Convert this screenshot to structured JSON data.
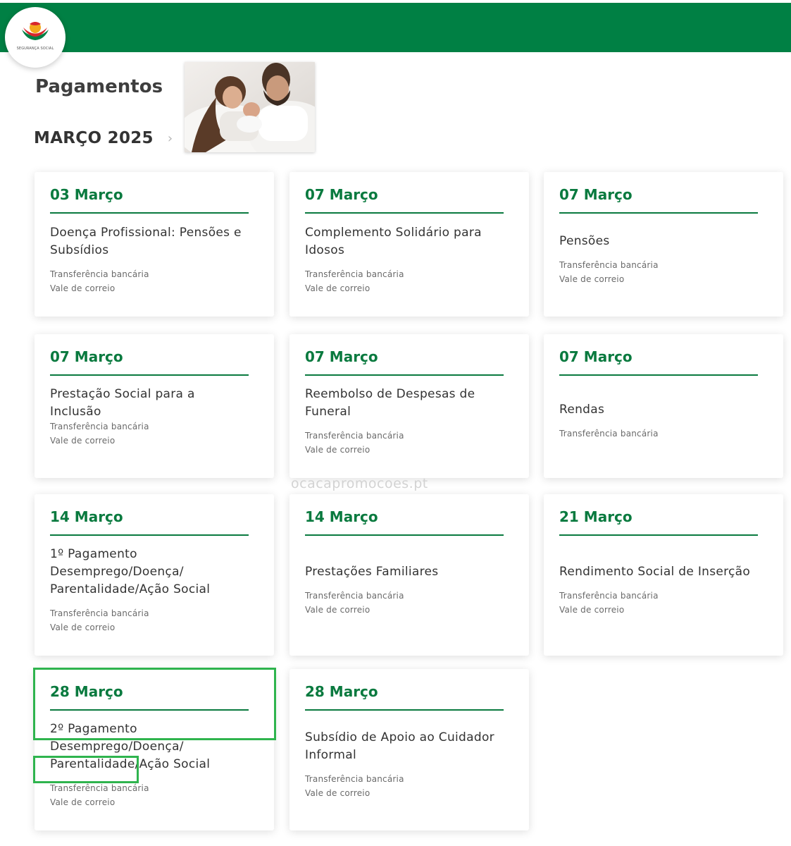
{
  "header": {
    "brand_color": "#008044",
    "logo_text": "SEGURANÇA SOCIAL"
  },
  "page": {
    "title": "Pagamentos",
    "month": "MARÇO 2025",
    "next_icon": "chevron-right-icon",
    "hero_image": "family-photo"
  },
  "watermark": "ocacapromocoes.pt",
  "accent_color": "#0a7a3f",
  "cards": [
    {
      "date": "03 Março",
      "title": "Doença Profissional: Pensões e Subsídios",
      "methods": [
        "Transferência bancária",
        "Vale de correio"
      ]
    },
    {
      "date": "07 Março",
      "title": "Complemento Solidário para Idosos",
      "methods": [
        "Transferência bancária",
        "Vale de correio"
      ]
    },
    {
      "date": "07 Março",
      "title": "Pensões",
      "methods": [
        "Transferência bancária",
        "Vale de correio"
      ]
    },
    {
      "date": "07 Março",
      "title": "Prestação Social para a Inclusão",
      "methods": [
        "Transferência bancária",
        "Vale de correio"
      ]
    },
    {
      "date": "07 Março",
      "title": "Reembolso de Despesas de Funeral",
      "methods": [
        "Transferência bancária",
        "Vale de correio"
      ]
    },
    {
      "date": "07 Março",
      "title": "Rendas",
      "methods": [
        "Transferência bancária"
      ]
    },
    {
      "date": "14 Março",
      "title": "1º Pagamento Desemprego/Doença/ Parentalidade/Ação Social",
      "methods": [
        "Transferência bancária",
        "Vale de correio"
      ]
    },
    {
      "date": "14 Março",
      "title": "Prestações Familiares",
      "methods": [
        "Transferência bancária",
        "Vale de correio"
      ]
    },
    {
      "date": "21 Março",
      "title": "Rendimento Social de Inserção",
      "methods": [
        "Transferência bancária",
        "Vale de correio"
      ]
    },
    {
      "date": "28 Março",
      "title": "2º Pagamento Desemprego/Doença/ Parentalidade/Ação Social",
      "methods": [
        "Transferência bancária",
        "Vale de correio"
      ]
    },
    {
      "date": "28 Março",
      "title": "Subsídio de Apoio ao Cuidador Informal",
      "methods": [
        "Transferência bancária",
        "Vale de correio"
      ]
    }
  ],
  "highlight_color": "#2fb44e"
}
